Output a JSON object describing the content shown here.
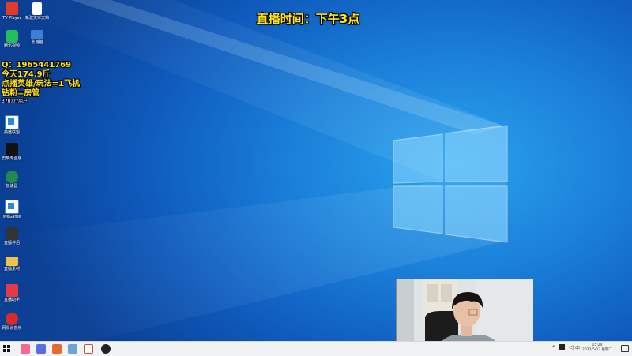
{
  "stream_title": "直播时间：下午3点",
  "overlay_lines": [
    "Q：1965441769",
    "今天174.9斤",
    "点播英雄/玩法=1飞机",
    "钻粉=房管"
  ],
  "overlay_small": "370???用户",
  "desktop_icons": [
    {
      "label": "TV Player",
      "color": "#e23b2a",
      "icon": "tv-app-icon"
    },
    {
      "label": "新建文本文档",
      "color": "#ffffff",
      "icon": "document-icon"
    },
    {
      "label": "腾讯视频",
      "color": "#21c05b",
      "icon": "video-app-icon"
    },
    {
      "label": "此电脑",
      "color": "#3b7fd6",
      "icon": "computer-icon"
    },
    {
      "label": "英雄联盟",
      "color": "#2b89d8",
      "icon": "game-launcher-icon"
    },
    {
      "label": "剪映专业版",
      "color": "#111111",
      "icon": "capcut-icon"
    },
    {
      "label": "加速器",
      "color": "#1f8a4c",
      "icon": "accelerator-icon"
    },
    {
      "label": "WeGame",
      "color": "#2b89d8",
      "icon": "wegame-icon"
    },
    {
      "label": "直播伴侣",
      "color": "#333333",
      "icon": "live-companion-icon"
    },
    {
      "label": "直播素材",
      "color": "#f1c24a",
      "icon": "folder-icon"
    },
    {
      "label": "直播助手",
      "color": "#e9374a",
      "icon": "live-assistant-icon"
    },
    {
      "label": "网易云音乐",
      "color": "#d92a2a",
      "icon": "music-icon"
    }
  ],
  "taskbar": {
    "apps": [
      {
        "name": "taskbar-app-1",
        "color": "#f26a8d"
      },
      {
        "name": "taskbar-app-2",
        "color": "#5b6de0"
      },
      {
        "name": "taskbar-app-3",
        "color": "#e86a2c"
      },
      {
        "name": "taskbar-app-4",
        "color": "#6aa7d8"
      },
      {
        "name": "taskbar-app-5",
        "color": "#e24a2a"
      },
      {
        "name": "taskbar-app-6",
        "color": "#222222"
      }
    ],
    "clock_time": "15:24",
    "clock_date": "2023/5/23 星期二"
  },
  "colors": {
    "overlay_text": "#ffe31a",
    "wallpaper": "#1a7fd8"
  }
}
